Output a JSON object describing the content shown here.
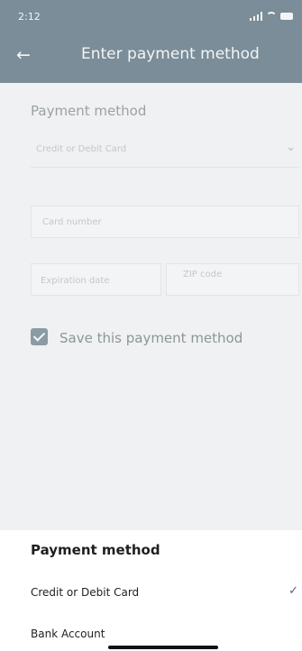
{
  "status_bar": {
    "time": "2:12"
  },
  "header": {
    "back_icon": "arrow-left-icon",
    "title": "Enter payment method"
  },
  "form": {
    "section_label": "Payment method",
    "payment_type_value": "Credit or Debit Card",
    "card_number_placeholder": "Card number",
    "expiration_placeholder": "Expiration date",
    "zip_placeholder": "ZIP code",
    "save_checkbox_label": "Save this payment method",
    "save_checked": true
  },
  "sheet": {
    "title": "Payment method",
    "options": [
      {
        "label": "Credit or Debit Card",
        "selected": true
      },
      {
        "label": "Bank Account",
        "selected": false
      }
    ],
    "selected_icon": "checkmark-icon"
  },
  "colors": {
    "header_bg": "#7a8d98",
    "dim_bg": "#eff1f2",
    "accent": "#7a4d8c"
  }
}
